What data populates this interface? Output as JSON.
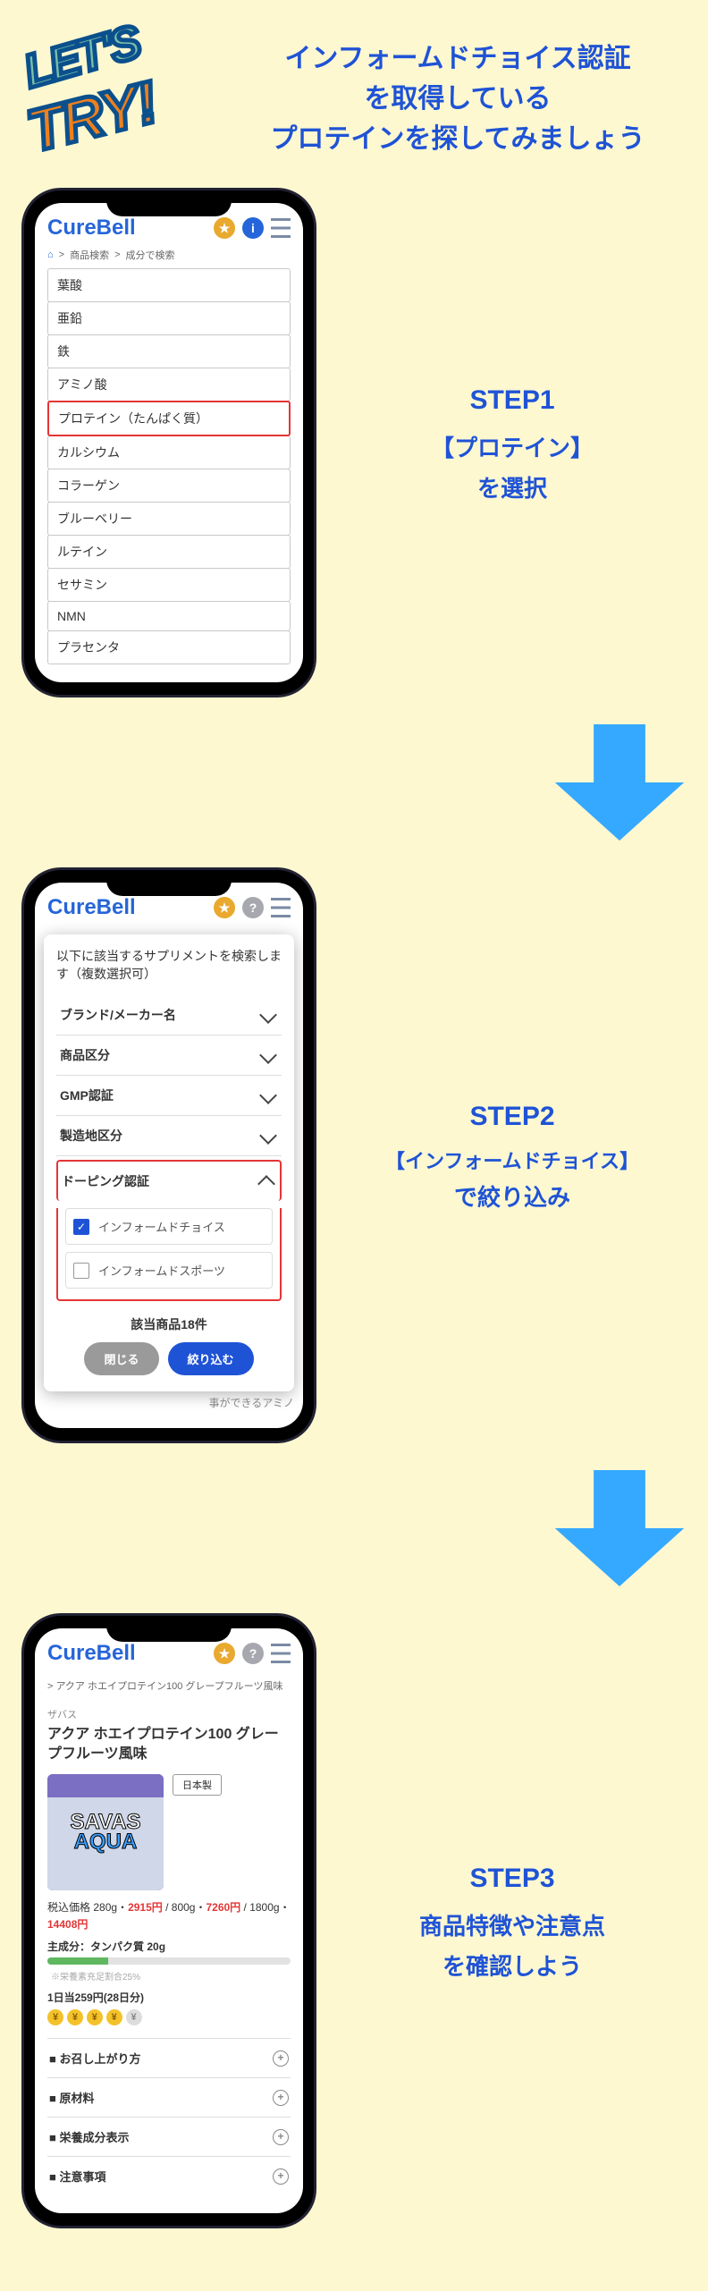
{
  "hero": {
    "line1": "インフォームドチョイス認証",
    "line2": "を取得している",
    "line3": "プロテインを探してみましょう",
    "lets": "LET'S",
    "try": "TRY!"
  },
  "app": {
    "brand": "CureBell"
  },
  "step1": {
    "title": "STEP1",
    "l1": "【プロテイン】",
    "l2": "を選択",
    "breadcrumb": {
      "home": "⌂",
      "b1": "商品検索",
      "b2": "成分で検索"
    },
    "items": [
      "葉酸",
      "亜鉛",
      "鉄",
      "アミノ酸",
      "プロテイン（たんぱく質）",
      "カルシウム",
      "コラーゲン",
      "ブルーベリー",
      "ルテイン",
      "セサミン",
      "NMN",
      "プラセンタ"
    ],
    "selectedIndex": 4
  },
  "step2": {
    "title": "STEP2",
    "l1": "【インフォームドチョイス】",
    "l2": "で絞り込み",
    "modalTitle": "以下に該当するサプリメントを検索します（複数選択可）",
    "filters": [
      "ブランド/メーカー名",
      "商品区分",
      "GMP認証",
      "製造地区分",
      "ドーピング認証"
    ],
    "options": [
      {
        "label": "インフォームドチョイス",
        "checked": true
      },
      {
        "label": "インフォームドスポーツ",
        "checked": false
      }
    ],
    "count": "該当商品18件",
    "close": "閉じる",
    "apply": "絞り込む",
    "bgPartial": "事ができるアミノ"
  },
  "step3": {
    "title": "STEP3",
    "l1": "商品特徴や注意点",
    "l2": "を確認しよう",
    "crumb": "アクア ホエイプロテイン100 グレープフルーツ風味",
    "brandName": "ザバス",
    "productName": "アクア ホエイプロテイン100 グレープフルーツ風味",
    "savas": "SAVAS",
    "aqua": "AQUA",
    "madeIn": "日本製",
    "priceLabel": "税込価格",
    "price1a": "280g・",
    "price1b": "2915円",
    "price2a": " / 800g・",
    "price2b": "7260円",
    "price3a": " / 1800g・",
    "price3b": "14408円",
    "compLabel": "主成分：",
    "comp": "タンパク質 20g",
    "nutriNote": "※栄養素充足割合25%",
    "perDay": "1日当259円(28日分)",
    "accordions": [
      "■ お召し上がり方",
      "■ 原材料",
      "■ 栄養成分表示",
      "■ 注意事項"
    ]
  }
}
